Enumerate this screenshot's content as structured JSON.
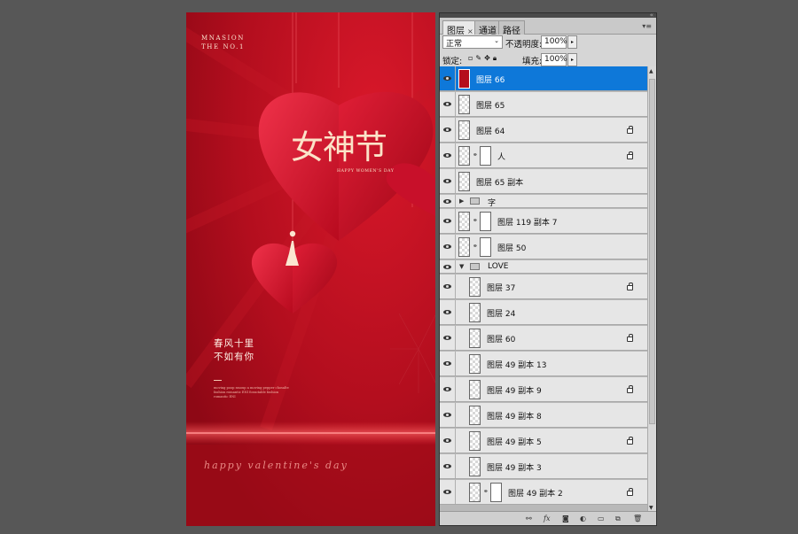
{
  "poster": {
    "brand_line1": "MNASION",
    "brand_line2": "THE NO.1",
    "title": "女神节",
    "subtitle": "HAPPY WOMEN'S DAY",
    "slogan_line1": "春风十里",
    "slogan_line2": "不如有你",
    "small_text": "moving poop smoup a moving pepper chosalte fashion romantic ENI fossotable fashion romantic ENI",
    "script": "happy valentine's day"
  },
  "panel": {
    "tabs": [
      {
        "label": "图层",
        "close": "×"
      },
      {
        "label": "通道"
      },
      {
        "label": "路径"
      }
    ],
    "menu_icon": "▾≡",
    "blend_mode": "正常",
    "opacity_label": "不透明度:",
    "opacity_value": "100%",
    "lock_label": "锁定:",
    "fill_label": "填充:",
    "fill_value": "100%",
    "layers": [
      {
        "name": "图层 66",
        "selected": true,
        "thumb": "red",
        "locked": false
      },
      {
        "name": "图层 65",
        "locked": false
      },
      {
        "name": "图层 64",
        "locked": true
      },
      {
        "name": "人",
        "locked": true,
        "mask": true,
        "figure": true
      },
      {
        "name": "图层 65 副本",
        "locked": false
      },
      {
        "name": "字",
        "group": true,
        "collapsed": true
      },
      {
        "name": "图层 119 副本 7",
        "mask": true,
        "chain": true
      },
      {
        "name": "图层 50",
        "mask": true,
        "chain": true
      },
      {
        "name": "LOVE",
        "group": true,
        "collapsed": false
      },
      {
        "name": "图层 37",
        "locked": true,
        "indent": true
      },
      {
        "name": "图层 24",
        "indent": true
      },
      {
        "name": "图层 60",
        "locked": true,
        "indent": true
      },
      {
        "name": "图层 49 副本 13",
        "indent": true
      },
      {
        "name": "图层 49 副本 9",
        "locked": true,
        "indent": true
      },
      {
        "name": "图层 49 副本 8",
        "indent": true
      },
      {
        "name": "图层 49 副本 5",
        "locked": true,
        "indent": true
      },
      {
        "name": "图层 49 副本 3",
        "indent": true
      },
      {
        "name": "图层 49 副本 2",
        "locked": true,
        "indent": true,
        "mask": true,
        "chain": true
      }
    ],
    "bottom_icons": [
      "link-icon",
      "fx-icon",
      "mask-icon",
      "adjustment-icon",
      "group-folder-icon",
      "new-layer-icon",
      "trash-icon"
    ]
  },
  "colors": {
    "poster_red": "#b50d1c",
    "selection_blue": "#0e78d9",
    "gold_text": "#fbe3c8"
  }
}
